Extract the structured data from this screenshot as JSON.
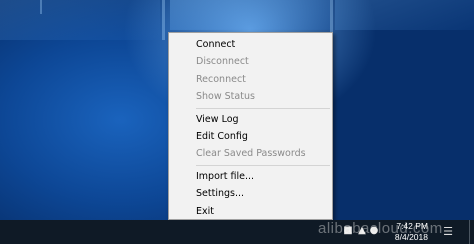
{
  "menu": {
    "items": [
      {
        "label": "Connect",
        "enabled": true
      },
      {
        "label": "Disconnect",
        "enabled": false
      },
      {
        "label": "Reconnect",
        "enabled": false
      },
      {
        "label": "Show Status",
        "enabled": false
      },
      {
        "separator": true
      },
      {
        "label": "View Log",
        "enabled": true
      },
      {
        "label": "Edit Config",
        "enabled": true
      },
      {
        "label": "Clear Saved Passwords",
        "enabled": false
      },
      {
        "separator": true
      },
      {
        "label": "Import file...",
        "enabled": true
      },
      {
        "label": "Settings...",
        "enabled": true
      },
      {
        "label": "Exit",
        "enabled": true
      }
    ]
  },
  "taskbar": {
    "time": "7:42 PM",
    "date": "8/4/2018",
    "tray_icons": [
      "network-icon",
      "volume-icon",
      "input-language-icon"
    ]
  },
  "watermark": "alibabacloud.com",
  "colors": {
    "menu_background": "#f2f2f2",
    "disabled_text": "#8a8a8a",
    "taskbar": "#0f1a26",
    "wallpaper": "#0d4796"
  }
}
